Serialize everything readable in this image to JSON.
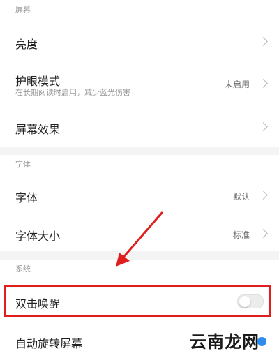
{
  "sections": {
    "screen": {
      "header": "屏幕",
      "brightness": {
        "title": "亮度"
      },
      "eye_care": {
        "title": "护眼模式",
        "subtitle": "在长期阅读时启用，减少蓝光伤害",
        "value": "未启用"
      },
      "display_effect": {
        "title": "屏幕效果"
      }
    },
    "font": {
      "header": "字体",
      "font": {
        "title": "字体",
        "value": "默认"
      },
      "font_size": {
        "title": "字体大小",
        "value": "标准"
      }
    },
    "system": {
      "header": "系统",
      "double_tap_wake": {
        "title": "双击唤醒",
        "enabled": false
      },
      "auto_rotate": {
        "title": "自动旋转屏幕"
      }
    }
  },
  "watermark": "云南龙网",
  "colors": {
    "highlight": "#e01e1e",
    "arrow": "#e01e1e",
    "section_gap": "#f4f4f4",
    "toggle_off": "#ececec",
    "accent_blue": "#2d8cf0"
  },
  "icons": {
    "chevron": "chevron-right-icon",
    "arrow_annotation": "arrow-icon"
  }
}
